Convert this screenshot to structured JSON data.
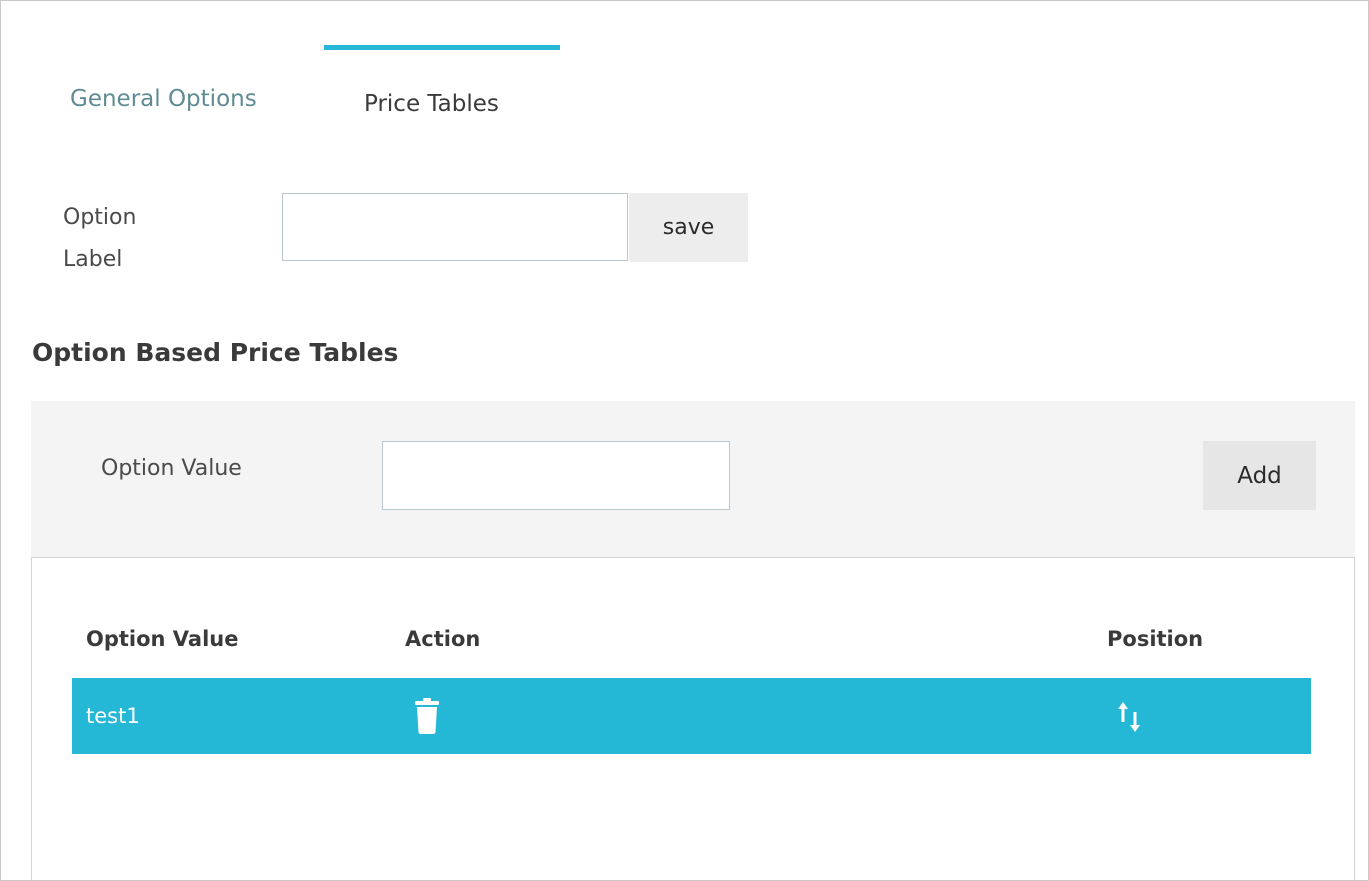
{
  "tabs": {
    "general_label": "General Options",
    "price_label": "Price Tables",
    "active": "Price Tables",
    "accent_color": "#25b7d6"
  },
  "option_label": {
    "label": "Option\nLabel",
    "value": "",
    "save_label": "save"
  },
  "section": {
    "title": "Option Based Price Tables"
  },
  "add_form": {
    "label": "Option Value",
    "value": "",
    "add_label": "Add"
  },
  "table": {
    "headers": [
      "Option Value",
      "Action",
      "Position"
    ],
    "rows": [
      {
        "option_value": "test1",
        "action_icon": "trash-icon",
        "position_icon": "sort-arrows-icon"
      }
    ],
    "row_color": "#25b7d6"
  }
}
